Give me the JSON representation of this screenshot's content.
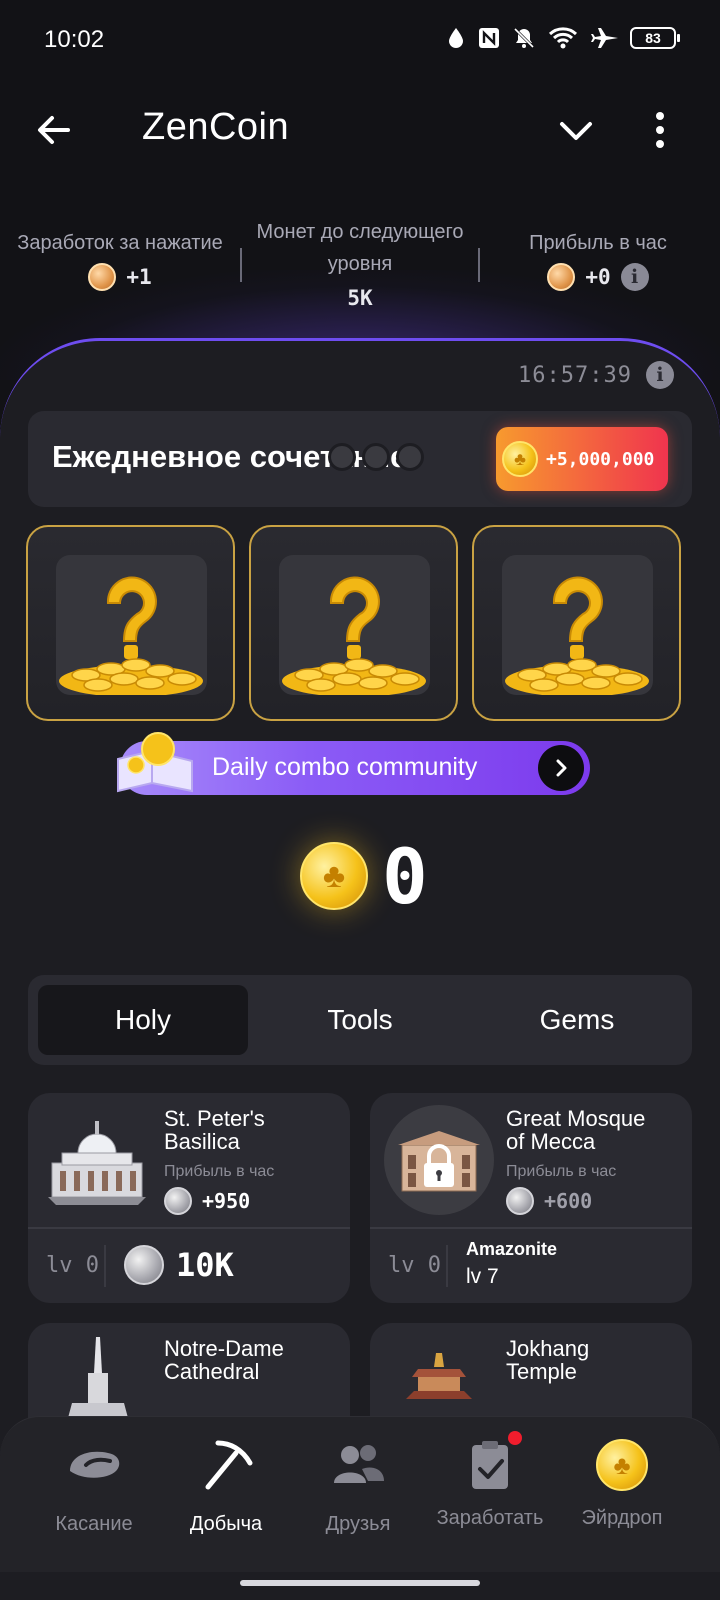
{
  "status_bar": {
    "time": "10:02",
    "battery": "83"
  },
  "header": {
    "title": "ZenCoin"
  },
  "stats": {
    "tap_label": "Заработок за нажатие",
    "tap_value": "+1",
    "next_level_label_1": "Монет до следующего",
    "next_level_label_2": "уровня",
    "next_level_value": "5K",
    "hourly_label": "Прибыль в час",
    "hourly_value": "+0"
  },
  "timer": "16:57:39",
  "daily_combo": {
    "title": "Ежедневное сочетание",
    "reward": "+5,000,000"
  },
  "community_button": {
    "label": "Daily combo community"
  },
  "balance": "0",
  "tabs": [
    {
      "label": "Holy",
      "active": true
    },
    {
      "label": "Tools",
      "active": false
    },
    {
      "label": "Gems",
      "active": false
    }
  ],
  "items": [
    {
      "name_1": "St. Peter's",
      "name_2": "Basilica",
      "profit_label": "Прибыль в час",
      "profit": "+950",
      "level": "lv 0",
      "price": "10K",
      "locked": false
    },
    {
      "name_1": "Great Mosque",
      "name_2": "of Mecca",
      "profit_label": "Прибыль в час",
      "profit": "+600",
      "level": "lv 0",
      "requirement_name": "Amazonite",
      "requirement_level": "lv 7",
      "locked": true
    },
    {
      "name_1": "Notre-Dame",
      "name_2": "Cathedral"
    },
    {
      "name_1": "Jokhang",
      "name_2": "Temple"
    }
  ],
  "nav": [
    {
      "label": "Касание",
      "icon": "tap-icon",
      "active": false
    },
    {
      "label": "Добыча",
      "icon": "pickaxe-icon",
      "active": true
    },
    {
      "label": "Друзья",
      "icon": "friends-icon",
      "active": false
    },
    {
      "label": "Заработать",
      "icon": "tasks-icon",
      "active": false,
      "badge": true
    },
    {
      "label": "Эйрдроп",
      "icon": "airdrop-coin-icon",
      "active": false
    }
  ],
  "colors": {
    "accent": "#6e4df0",
    "gold": "#f5c21a",
    "badge": "#f01d2d"
  }
}
